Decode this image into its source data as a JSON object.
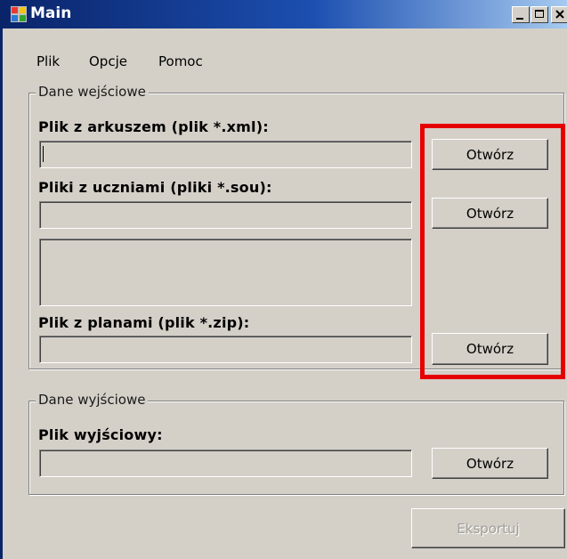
{
  "window": {
    "title": "Main"
  },
  "menu": {
    "items": [
      "Plik",
      "Opcje",
      "Pomoc"
    ]
  },
  "input_group": {
    "legend": "Dane wejściowe",
    "sheet_label": "Plik z arkuszem (plik *.xml):",
    "sheet_value": "",
    "students_label": "Pliki z uczniami (pliki *.sou):",
    "students_value": "",
    "students_list": "",
    "plans_label": "Plik z planami (plik *.zip):",
    "plans_value": "",
    "open_label": "Otwórz"
  },
  "output_group": {
    "legend": "Dane wyjściowe",
    "output_label": "Plik wyjściowy:",
    "output_value": "",
    "open_label": "Otwórz"
  },
  "footer": {
    "export_label": "Eksportuj"
  },
  "colors": {
    "highlight": "#e60000",
    "titlebar": "#0a246a"
  }
}
